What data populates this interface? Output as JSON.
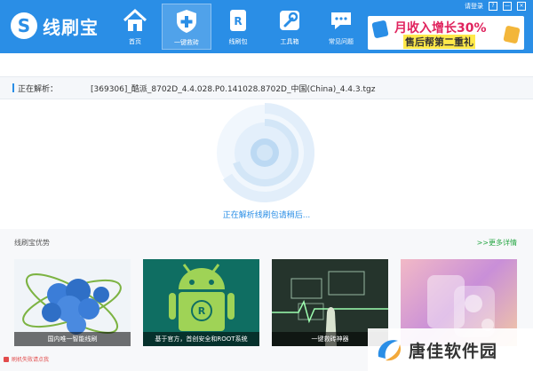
{
  "app": {
    "logo_letter": "S",
    "title": "线刷宝"
  },
  "nav": [
    {
      "label": "首页",
      "icon": "home-icon"
    },
    {
      "label": "一键救砖",
      "icon": "shield-plus-icon"
    },
    {
      "label": "线刷包",
      "icon": "package-icon"
    },
    {
      "label": "工具箱",
      "icon": "wrench-icon"
    },
    {
      "label": "常见问题",
      "icon": "chat-icon"
    }
  ],
  "banner": {
    "line1": "月收入增长30%",
    "line2": "售后帮第二重礼"
  },
  "top_tools": {
    "login": "请登录",
    "help": "?",
    "minimize": "—",
    "close": "×"
  },
  "parse": {
    "label": "正在解析：",
    "file": "[369306]_酷派_8702D_4.4.028.P0.141028.8702D_中国(China)_4.4.3.tgz"
  },
  "status_text": "正在解析线刷包请稍后...",
  "advantages": {
    "title": "线刷宝优势",
    "more": ">>更多详情",
    "cards": [
      {
        "caption": "国内唯一智能线刷"
      },
      {
        "caption": "基于官方，首创安全和ROOT系统"
      },
      {
        "caption": "一键救砖神器"
      },
      {
        "caption": ""
      }
    ]
  },
  "footer": {
    "status": "刷机失败请点我"
  },
  "watermark": {
    "text": "唐佳软件园"
  },
  "colors": {
    "brand": "#2a8ee6",
    "accent_green": "#28a745",
    "error": "#e24b4b"
  }
}
